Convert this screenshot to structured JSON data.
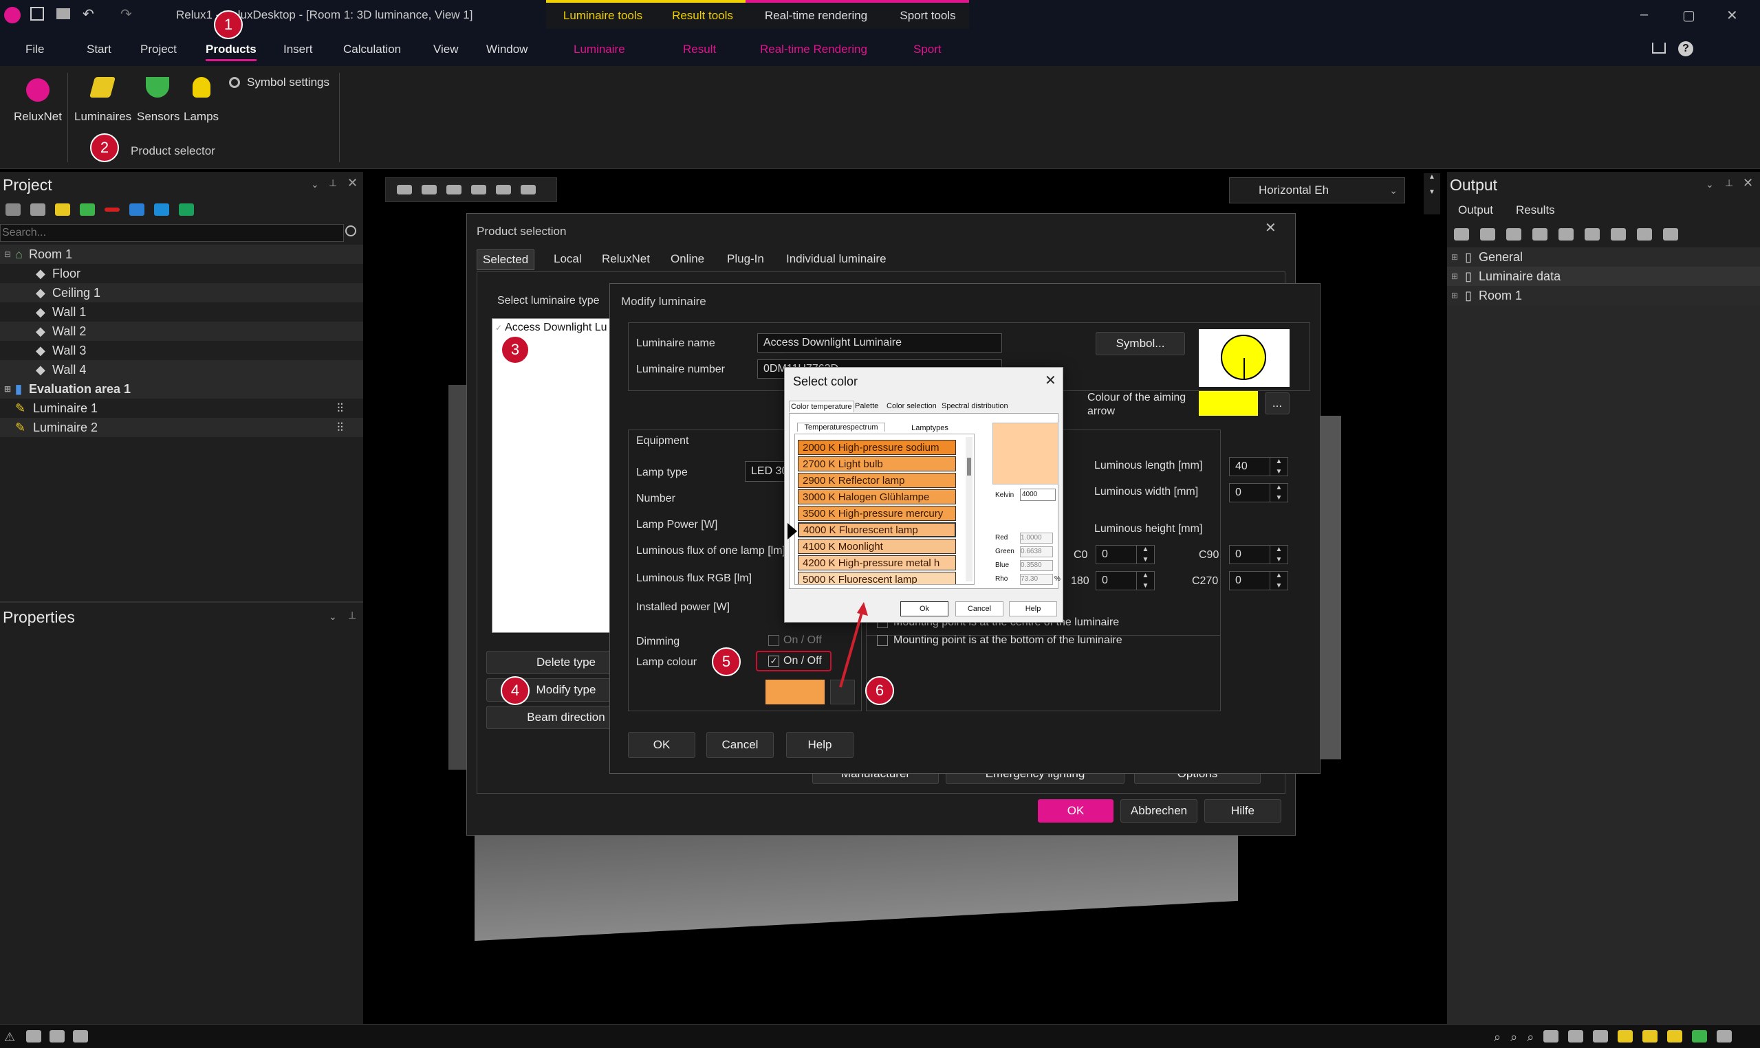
{
  "titlebar": {
    "title": "Relux1 - ReluxDesktop - [Room 1: 3D luminance, View 1]",
    "ctx_tabs": [
      "Luminaire tools",
      "Result tools",
      "Real-time rendering",
      "Sport tools"
    ],
    "window_buttons": [
      "–",
      "▢",
      "✕"
    ]
  },
  "menu": {
    "items": [
      "File",
      "Start",
      "Project",
      "Products",
      "Insert",
      "Calculation",
      "View",
      "Window"
    ],
    "context_items": [
      "Luminaire",
      "Result",
      "Real-time Rendering",
      "Sport"
    ]
  },
  "ribbon": {
    "relux_net": "ReluxNet",
    "luminaires": "Luminaires",
    "sensors": "Sensors",
    "lamps": "Lamps",
    "symbol_settings": "Symbol settings",
    "group_label": "Product selector"
  },
  "project": {
    "title": "Project",
    "search_placeholder": "Search...",
    "tree": [
      "Room 1",
      "Floor",
      "Ceiling 1",
      "Wall 1",
      "Wall 2",
      "Wall 3",
      "Wall 4",
      "Evaluation area 1",
      "Luminaire  1",
      "Luminaire  2"
    ]
  },
  "properties": {
    "title": "Properties"
  },
  "view": {
    "dropdown": "Horizontal Eh"
  },
  "output": {
    "title": "Output",
    "tabs": [
      "Output",
      "Results"
    ],
    "tree": [
      "General",
      "Luminaire data",
      "Room 1"
    ]
  },
  "product_selection": {
    "title": "Product selection",
    "tabs": [
      "Selected",
      "Local",
      "ReluxNet",
      "Online",
      "Plug-In",
      "Individual luminaire"
    ],
    "select_type_label": "Select luminaire type",
    "list_item": "Access Downlight Lu",
    "delete_type": "Delete type",
    "modify_type": "Modify type",
    "beam_direction": "Beam direction",
    "hidden_buttons": [
      "Manufacturer",
      "Emergency lighting",
      "Options"
    ],
    "ok": "OK",
    "cancel": "Abbrechen",
    "help": "Hilfe"
  },
  "modify_luminaire": {
    "title": "Modify luminaire",
    "name_label": "Luminaire name",
    "name_value": "Access Downlight Luminaire",
    "number_label": "Luminaire number",
    "number_value": "0DM11H7763D",
    "symbol_button": "Symbol...",
    "aiming_label": "Colour of the aiming arrow",
    "aiming_color": "#ffff00",
    "more_button": "...",
    "equipment": "Equipment",
    "lamp_type_label": "Lamp type",
    "lamp_type_value": "LED 30",
    "number_lbl": "Number",
    "lamp_power": "Lamp Power [W]",
    "flux_one": "Luminous flux of one lamp [lm]",
    "flux_rgb": "Luminous flux RGB [lm]",
    "installed_power": "Installed power [W]",
    "dimming": "Dimming",
    "dimming_toggle": "On / Off",
    "lamp_colour": "Lamp colour",
    "lamp_colour_toggle": "On / Off",
    "lamp_color_hex": "#f4a04a",
    "lum_length_label": "Luminous length [mm]",
    "lum_length": "40",
    "lum_width_label": "Luminous width [mm]",
    "lum_width": "0",
    "lum_height_label": "Luminous height [mm]",
    "c0_label": "C0",
    "c0": "0",
    "c90_label": "C90",
    "c90": "0",
    "c180_label": "180",
    "c180": "0",
    "c270_label": "C270",
    "c270": "0",
    "mount_centre": "Mounting point is at the centre of the luminaire",
    "mount_bottom": "Mounting point is at the bottom of the luminaire",
    "ok": "OK",
    "cancel": "Cancel",
    "help": "Help"
  },
  "select_color": {
    "title": "Select color",
    "tabs": [
      "Color temperature",
      "Palette",
      "Color selection",
      "Spectral distribution"
    ],
    "subtabs": [
      "Temperaturespectrum",
      "Lamptypes"
    ],
    "items": [
      "2000 K  High-pressure sodium",
      "2700 K  Light bulb",
      "2900 K  Reflector lamp",
      "3000 K  Halogen Glühlampe",
      "3500 K  High-pressure mercury",
      "4000 K  Fluorescent lamp",
      "4100 K  Moonlight",
      "4200 K  High-pressure metal h",
      "5000 K  Fluorescent lamp"
    ],
    "kelvin_label": "Kelvin",
    "kelvin_value": "4000",
    "red_label": "Red",
    "red": "1.0000",
    "green_label": "Green",
    "green": "0.6638",
    "blue_label": "Blue",
    "blue": "0.3580",
    "rho_label": "Rho",
    "rho": "73.30",
    "rho_unit": "%",
    "ok": "Ok",
    "cancel": "Cancel",
    "help": "Help",
    "preview_color": "#ffcfa0"
  },
  "badges": [
    "1",
    "2",
    "3",
    "4",
    "5",
    "6"
  ]
}
